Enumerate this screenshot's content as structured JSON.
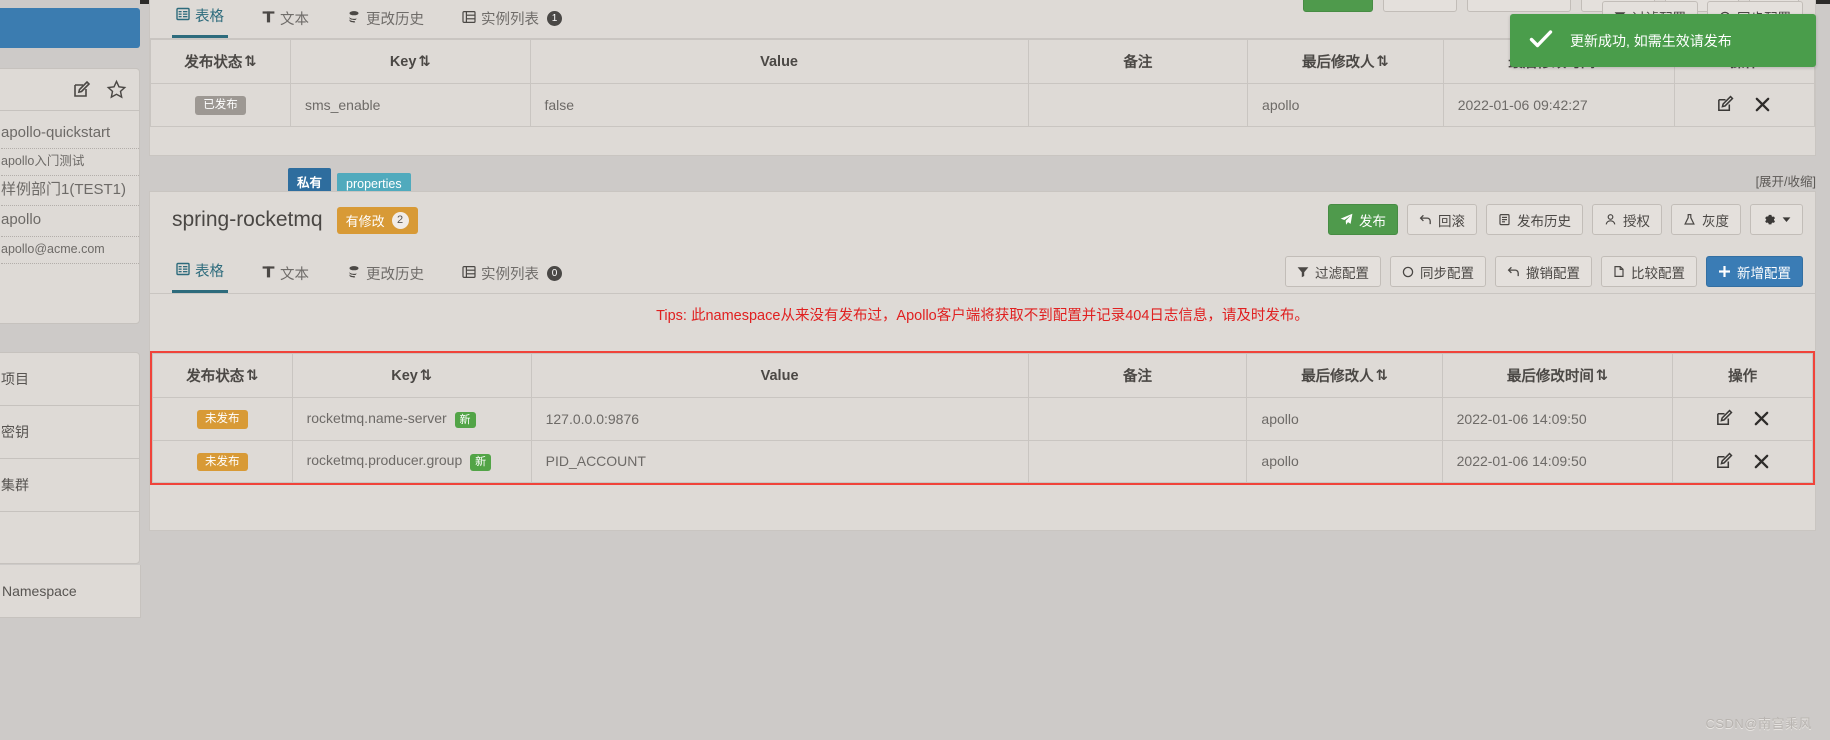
{
  "sidebar": {
    "profile": {
      "icons": [
        "edit-square-icon",
        "star-icon"
      ],
      "rows": [
        {
          "text": "apollo-quickstart",
          "size": "big"
        },
        {
          "text": "apollo入门测试",
          "size": "small"
        },
        {
          "text": "样例部门1(TEST1)",
          "size": "big"
        },
        {
          "text": "apollo",
          "size": "big"
        },
        {
          "text": "apollo@acme.com",
          "size": "small"
        }
      ]
    },
    "nav": [
      {
        "label": "项目"
      },
      {
        "label": "密钥"
      },
      {
        "label": "集群"
      },
      {
        "label": "Namespace"
      }
    ]
  },
  "toast": {
    "icon": "check-icon",
    "message": "更新成功, 如需生效请发布"
  },
  "top_card": {
    "tabs": [
      {
        "label": "表格",
        "icon": "table-icon",
        "active": true,
        "badge": ""
      },
      {
        "label": "文本",
        "icon": "text-icon",
        "active": false,
        "badge": ""
      },
      {
        "label": "更改历史",
        "icon": "history-icon",
        "active": false,
        "badge": ""
      },
      {
        "label": "实例列表",
        "icon": "instances-icon",
        "active": false,
        "badge": "1"
      }
    ],
    "toolbar": [
      {
        "label": "过滤配置",
        "icon": "filter-icon",
        "style": "default"
      },
      {
        "label": "同步配置",
        "icon": "sync-icon",
        "style": "default"
      }
    ],
    "table": {
      "columns": [
        {
          "label": "发布状态",
          "sortable": true
        },
        {
          "label": "Key",
          "sortable": true
        },
        {
          "label": "Value",
          "sortable": false
        },
        {
          "label": "备注",
          "sortable": false
        },
        {
          "label": "最后修改人",
          "sortable": true
        },
        {
          "label": "最后修改时间",
          "sortable": true
        },
        {
          "label": "操作",
          "sortable": false
        }
      ],
      "rows": [
        {
          "status": "已发布",
          "status_kind": "published",
          "key": "sms_enable",
          "is_new": false,
          "value": "false",
          "remark": "",
          "modified_by": "apollo",
          "modified_at": "2022-01-06 09:42:27"
        }
      ]
    }
  },
  "namespace": {
    "tag_private": "私有",
    "tag_format": "properties",
    "expand_link": "[展开/收缩]",
    "title": "spring-rocketmq",
    "modified_badge": {
      "label": "有修改",
      "count": "2"
    },
    "header_buttons": [
      {
        "label": "发布",
        "icon": "send-icon",
        "style": "green"
      },
      {
        "label": "回滚",
        "icon": "rollback-icon",
        "style": "default"
      },
      {
        "label": "发布历史",
        "icon": "clipboard-icon",
        "style": "default"
      },
      {
        "label": "授权",
        "icon": "user-icon",
        "style": "default"
      },
      {
        "label": "灰度",
        "icon": "flask-icon",
        "style": "default"
      },
      {
        "label": "",
        "icon": "gear-caret-icon",
        "style": "default"
      }
    ],
    "tabs": [
      {
        "label": "表格",
        "icon": "table-icon",
        "active": true,
        "badge": ""
      },
      {
        "label": "文本",
        "icon": "text-icon",
        "active": false,
        "badge": ""
      },
      {
        "label": "更改历史",
        "icon": "history-icon",
        "active": false,
        "badge": ""
      },
      {
        "label": "实例列表",
        "icon": "instances-icon",
        "active": false,
        "badge": "0"
      }
    ],
    "toolbar": [
      {
        "label": "过滤配置",
        "icon": "filter-icon",
        "style": "default"
      },
      {
        "label": "同步配置",
        "icon": "sync-icon",
        "style": "default"
      },
      {
        "label": "撤销配置",
        "icon": "rollback-icon",
        "style": "default"
      },
      {
        "label": "比较配置",
        "icon": "compare-icon",
        "style": "default"
      },
      {
        "label": "新增配置",
        "icon": "plus-icon",
        "style": "primary"
      }
    ],
    "tips": "Tips: 此namespace从来没有发布过，Apollo客户端将获取不到配置并记录404日志信息，请及时发布。",
    "table": {
      "columns": [
        {
          "label": "发布状态",
          "sortable": true
        },
        {
          "label": "Key",
          "sortable": true
        },
        {
          "label": "Value",
          "sortable": false
        },
        {
          "label": "备注",
          "sortable": false
        },
        {
          "label": "最后修改人",
          "sortable": true
        },
        {
          "label": "最后修改时间",
          "sortable": true
        },
        {
          "label": "操作",
          "sortable": false
        }
      ],
      "rows": [
        {
          "status": "未发布",
          "status_kind": "unpublished",
          "key": "rocketmq.name-server",
          "is_new": true,
          "new_label": "新",
          "value": "127.0.0.0:9876",
          "remark": "",
          "modified_by": "apollo",
          "modified_at": "2022-01-06 14:09:50"
        },
        {
          "status": "未发布",
          "status_kind": "unpublished",
          "key": "rocketmq.producer.group",
          "is_new": true,
          "new_label": "新",
          "value": "PID_ACCOUNT",
          "remark": "",
          "modified_by": "apollo",
          "modified_at": "2022-01-06 14:09:50"
        }
      ]
    }
  },
  "watermark": "CSDN@南宫乘风",
  "colors": {
    "accent_blue": "#3a7cb5",
    "green": "#4f9a4c",
    "orange": "#d89a36",
    "teal": "#2d6b7c",
    "danger_red": "#e02020",
    "highlight_red": "#f0433a"
  }
}
